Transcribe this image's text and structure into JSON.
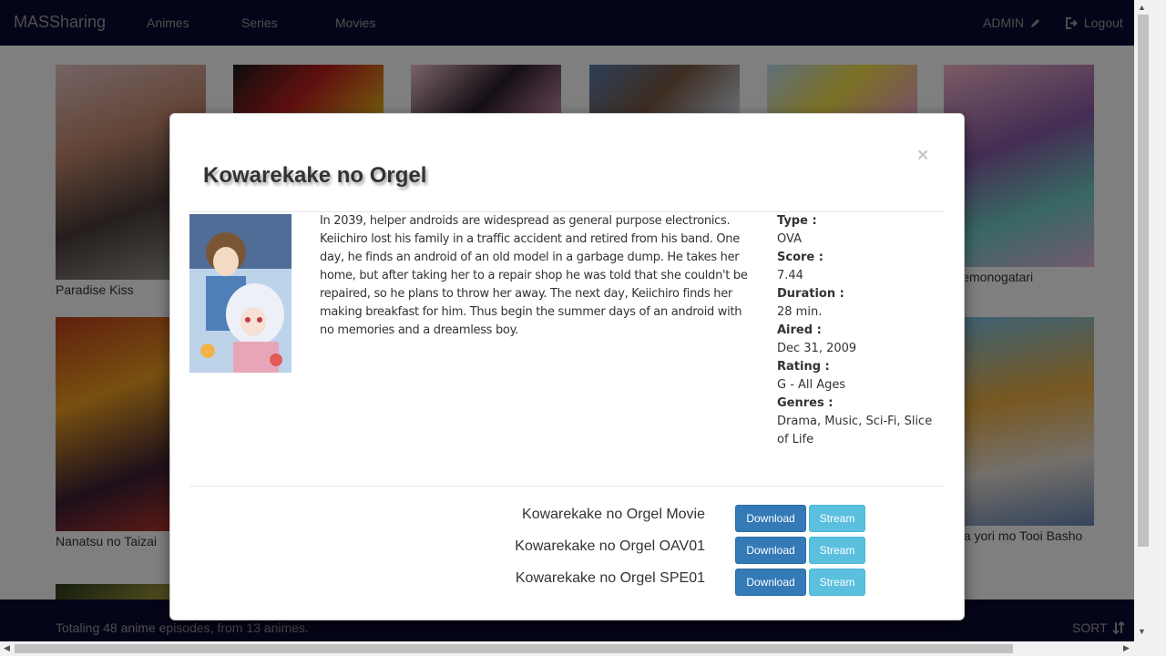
{
  "navbar": {
    "brand": "MASSharing",
    "links": [
      "Animes",
      "Series",
      "Movies"
    ],
    "admin": "ADMIN",
    "logout": "Logout"
  },
  "grid": {
    "posters": [
      {
        "title": "Paradise Kiss"
      },
      {
        "title": "Nanatsu no Taizai"
      },
      {
        "title": "Nisemonogatari"
      },
      {
        "title": "Sora yori mo Tooi Basho"
      }
    ]
  },
  "footer": {
    "total": "Totaling 48 anime episodes, from 13 animes.",
    "sort": "SORT"
  },
  "modal": {
    "title": "Kowarekake no Orgel",
    "close": "×",
    "synopsis": "In 2039, helper androids are widespread as general purpose electronics. Keiichiro lost his family in a traffic accident and retired from his band. One day, he finds an android of an old model in a garbage dump. He takes her home, but after taking her to a repair shop he was told that she couldn't be repaired, so he plans to throw her away. The next day, Keiichiro finds her making breakfast for him. Thus begin the summer days of an android with no memories and a dreamless boy.",
    "info": {
      "type_label": "Type :",
      "type": "OVA",
      "score_label": "Score :",
      "score": "7.44",
      "duration_label": "Duration :",
      "duration": "28 min.",
      "aired_label": "Aired :",
      "aired": "Dec 31, 2009",
      "rating_label": "Rating :",
      "rating": "G - All Ages",
      "genres_label": "Genres :",
      "genres": "Drama, Music, Sci-Fi, Slice of Life"
    },
    "episodes": [
      {
        "name": "Kowarekake no Orgel Movie",
        "download": "Download",
        "stream": "Stream"
      },
      {
        "name": "Kowarekake no Orgel OAV01",
        "download": "Download",
        "stream": "Stream"
      },
      {
        "name": "Kowarekake no Orgel SPE01",
        "download": "Download",
        "stream": "Stream"
      }
    ]
  },
  "colors": {
    "navbar_bg": "#0a0a33",
    "primary": "#337ab7",
    "info": "#5bc0de"
  }
}
